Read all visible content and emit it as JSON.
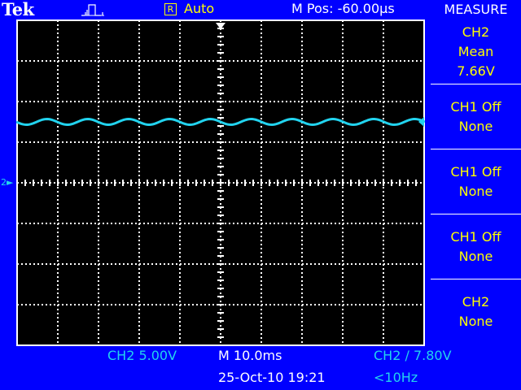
{
  "header": {
    "brand": "Tek",
    "trigger_state_icon": "run-pulse-icon",
    "trigger_mode_badge": "R",
    "trigger_mode": "Auto",
    "m_pos": "M Pos: -60.00µs"
  },
  "measure_panel": {
    "title": "MEASURE",
    "buttons": [
      {
        "lines": [
          "CH2",
          "Mean",
          "7.66V"
        ]
      },
      {
        "lines": [
          "CH1 Off",
          "None"
        ]
      },
      {
        "lines": [
          "CH1 Off",
          "None"
        ]
      },
      {
        "lines": [
          "CH1 Off",
          "None"
        ]
      },
      {
        "lines": [
          "CH2",
          "None"
        ]
      }
    ]
  },
  "channel_marker": "2",
  "status": {
    "ch2_scale": "CH2  5.00V",
    "timebase": "M 10.0ms",
    "trigger": "CH2 ∕ 7.80V",
    "date_time": "25-Oct-10 19:21",
    "trigger_freq": "<10Hz"
  },
  "colors": {
    "background": "#0000ff",
    "screen": "#000000",
    "ch2_trace": "#22d3ee",
    "softkey_text": "#ffff00",
    "grid": "#ffffff"
  },
  "waveform": {
    "channel": "CH2",
    "mean_level_divisions_above_center": 1.5,
    "ripple_cycles_on_screen": 10,
    "ripple_peak_to_peak_divisions": 0.14
  }
}
